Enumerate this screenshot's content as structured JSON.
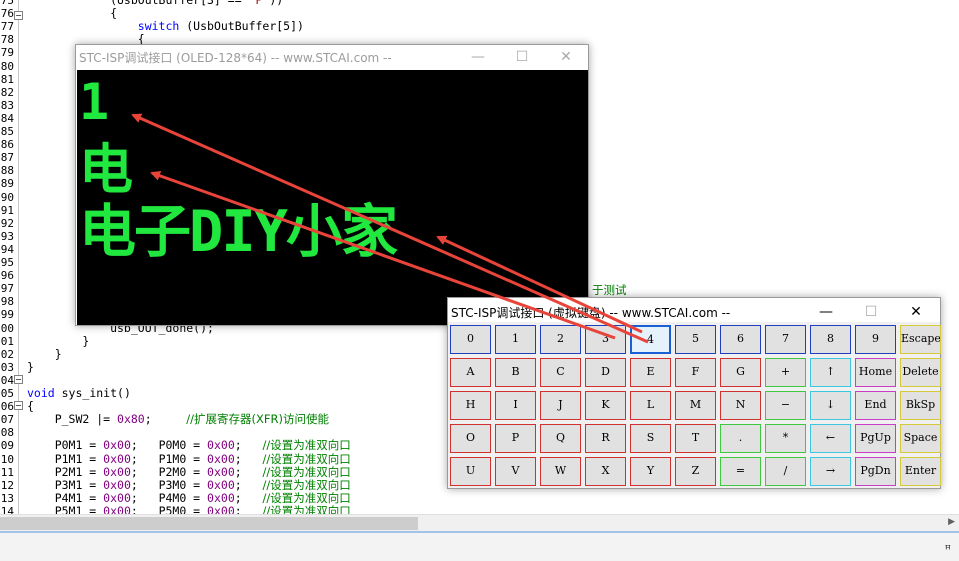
{
  "editor": {
    "lines": [
      {
        "n": "75",
        "parts": [
          [
            "",
            "            (UsbOutBuffer[3] == "
          ],
          [
            "str",
            "'P'"
          ],
          [
            "",
            "))"
          ]
        ]
      },
      {
        "n": "76",
        "parts": [
          [
            "",
            "            {"
          ]
        ]
      },
      {
        "n": "77",
        "parts": [
          [
            "",
            "                "
          ],
          [
            "kw",
            "switch"
          ],
          [
            "",
            " (UsbOutBuffer[5])"
          ]
        ]
      },
      {
        "n": "78",
        "parts": [
          [
            "",
            "                {"
          ]
        ]
      },
      {
        "n": "79",
        "parts": []
      },
      {
        "n": "80",
        "parts": []
      },
      {
        "n": "81",
        "parts": []
      },
      {
        "n": "82",
        "parts": []
      },
      {
        "n": "83",
        "parts": []
      },
      {
        "n": "84",
        "parts": []
      },
      {
        "n": "85",
        "parts": []
      },
      {
        "n": "86",
        "parts": []
      },
      {
        "n": "87",
        "parts": []
      },
      {
        "n": "88",
        "parts": []
      },
      {
        "n": "89",
        "parts": []
      },
      {
        "n": "90",
        "parts": []
      },
      {
        "n": "91",
        "parts": []
      },
      {
        "n": "92",
        "parts": []
      },
      {
        "n": "93",
        "parts": []
      },
      {
        "n": "94",
        "parts": []
      },
      {
        "n": "95",
        "parts": []
      },
      {
        "n": "96",
        "parts": []
      },
      {
        "n": "97",
        "parts": []
      },
      {
        "n": "98",
        "parts": []
      },
      {
        "n": "99",
        "parts": []
      },
      {
        "n": "00",
        "parts": [
          [
            "",
            "            usb_OUT_done();"
          ]
        ]
      },
      {
        "n": "01",
        "parts": [
          [
            "",
            "        }"
          ]
        ]
      },
      {
        "n": "02",
        "parts": [
          [
            "",
            "    }"
          ]
        ]
      },
      {
        "n": "03",
        "parts": [
          [
            "",
            "}"
          ]
        ]
      },
      {
        "n": "04",
        "parts": []
      },
      {
        "n": "05",
        "parts": [
          [
            "kw",
            "void"
          ],
          [
            "",
            " sys_init()"
          ]
        ]
      },
      {
        "n": "06",
        "parts": [
          [
            "",
            "{"
          ]
        ]
      },
      {
        "n": "07",
        "parts": [
          [
            "",
            "    P_SW2 |= "
          ],
          [
            "num",
            "0x80"
          ],
          [
            "",
            ";     "
          ],
          [
            "cm",
            "//扩展寄存器(XFR)访问使能"
          ]
        ]
      },
      {
        "n": "08",
        "parts": []
      },
      {
        "n": "09",
        "parts": [
          [
            "",
            "    P0M1 = "
          ],
          [
            "num",
            "0x00"
          ],
          [
            "",
            ";   P0M0 = "
          ],
          [
            "num",
            "0x00"
          ],
          [
            "",
            ";   "
          ],
          [
            "cm",
            "//设置为准双向口"
          ]
        ]
      },
      {
        "n": "10",
        "parts": [
          [
            "",
            "    P1M1 = "
          ],
          [
            "num",
            "0x00"
          ],
          [
            "",
            ";   P1M0 = "
          ],
          [
            "num",
            "0x00"
          ],
          [
            "",
            ";   "
          ],
          [
            "cm",
            "//设置为准双向口"
          ]
        ]
      },
      {
        "n": "11",
        "parts": [
          [
            "",
            "    P2M1 = "
          ],
          [
            "num",
            "0x00"
          ],
          [
            "",
            ";   P2M0 = "
          ],
          [
            "num",
            "0x00"
          ],
          [
            "",
            ";   "
          ],
          [
            "cm",
            "//设置为准双向口"
          ]
        ]
      },
      {
        "n": "12",
        "parts": [
          [
            "",
            "    P3M1 = "
          ],
          [
            "num",
            "0x00"
          ],
          [
            "",
            ";   P3M0 = "
          ],
          [
            "num",
            "0x00"
          ],
          [
            "",
            ";   "
          ],
          [
            "cm",
            "//设置为准双向口"
          ]
        ]
      },
      {
        "n": "13",
        "parts": [
          [
            "",
            "    P4M1 = "
          ],
          [
            "num",
            "0x00"
          ],
          [
            "",
            ";   P4M0 = "
          ],
          [
            "num",
            "0x00"
          ],
          [
            "",
            ";   "
          ],
          [
            "cm",
            "//设置为准双向口"
          ]
        ]
      },
      {
        "n": "14",
        "parts": [
          [
            "",
            "    P5M1 = "
          ],
          [
            "num",
            "0x00"
          ],
          [
            "",
            ";   P5M0 = "
          ],
          [
            "num",
            "0x00"
          ],
          [
            "",
            ";   "
          ],
          [
            "cm",
            "//设置为准双向口"
          ]
        ]
      }
    ],
    "side_comment": "于测试"
  },
  "oled_window": {
    "title": "STC-ISP调试接口 (OLED-128*64) -- www.STCAI.com --",
    "minimize": "—",
    "maximize": "☐",
    "close": "✕",
    "lines": [
      "1",
      "电",
      "电子DIY小家"
    ]
  },
  "keyboard_window": {
    "title": "STC-ISP调试接口 (虚拟键盘) -- www.STCAI.com --",
    "minimize": "—",
    "maximize": "☐",
    "close": "✕",
    "selected_key": "4",
    "rows": [
      [
        {
          "l": "0",
          "c": "#1f3fbf"
        },
        {
          "l": "1",
          "c": "#1f3fbf"
        },
        {
          "l": "2",
          "c": "#1f3fbf"
        },
        {
          "l": "3",
          "c": "#1f3fbf"
        },
        {
          "l": "4",
          "c": "#1f3fbf"
        },
        {
          "l": "5",
          "c": "#1f3fbf"
        },
        {
          "l": "6",
          "c": "#1f3fbf"
        },
        {
          "l": "7",
          "c": "#1f3fbf"
        },
        {
          "l": "8",
          "c": "#1f3fbf"
        },
        {
          "l": "9",
          "c": "#1f3fbf"
        },
        {
          "l": "Escape",
          "c": "#d6c93a"
        }
      ],
      [
        {
          "l": "A",
          "c": "#d03030"
        },
        {
          "l": "B",
          "c": "#d03030"
        },
        {
          "l": "C",
          "c": "#d03030"
        },
        {
          "l": "D",
          "c": "#d03030"
        },
        {
          "l": "E",
          "c": "#d03030"
        },
        {
          "l": "F",
          "c": "#d03030"
        },
        {
          "l": "G",
          "c": "#d03030"
        },
        {
          "l": "+",
          "c": "#3ec93e"
        },
        {
          "l": "↑",
          "c": "#3cc7e0"
        },
        {
          "l": "Home",
          "c": "#c83cc8"
        },
        {
          "l": "Delete",
          "c": "#d6c93a"
        }
      ],
      [
        {
          "l": "H",
          "c": "#d03030"
        },
        {
          "l": "I",
          "c": "#d03030"
        },
        {
          "l": "J",
          "c": "#d03030"
        },
        {
          "l": "K",
          "c": "#d03030"
        },
        {
          "l": "L",
          "c": "#d03030"
        },
        {
          "l": "M",
          "c": "#d03030"
        },
        {
          "l": "N",
          "c": "#d03030"
        },
        {
          "l": "−",
          "c": "#3ec93e"
        },
        {
          "l": "↓",
          "c": "#3cc7e0"
        },
        {
          "l": "End",
          "c": "#c83cc8"
        },
        {
          "l": "BkSp",
          "c": "#d6c93a"
        }
      ],
      [
        {
          "l": "O",
          "c": "#d03030"
        },
        {
          "l": "P",
          "c": "#d03030"
        },
        {
          "l": "Q",
          "c": "#d03030"
        },
        {
          "l": "R",
          "c": "#d03030"
        },
        {
          "l": "S",
          "c": "#d03030"
        },
        {
          "l": "T",
          "c": "#d03030"
        },
        {
          "l": ".",
          "c": "#3ec93e"
        },
        {
          "l": "*",
          "c": "#3ec93e"
        },
        {
          "l": "←",
          "c": "#3cc7e0"
        },
        {
          "l": "PgUp",
          "c": "#c83cc8"
        },
        {
          "l": "Space",
          "c": "#d6c93a"
        }
      ],
      [
        {
          "l": "U",
          "c": "#d03030"
        },
        {
          "l": "V",
          "c": "#d03030"
        },
        {
          "l": "W",
          "c": "#d03030"
        },
        {
          "l": "X",
          "c": "#d03030"
        },
        {
          "l": "Y",
          "c": "#d03030"
        },
        {
          "l": "Z",
          "c": "#d03030"
        },
        {
          "l": "=",
          "c": "#3ec93e"
        },
        {
          "l": "/",
          "c": "#3ec93e"
        },
        {
          "l": "→",
          "c": "#3cc7e0"
        },
        {
          "l": "PgDn",
          "c": "#c83cc8"
        },
        {
          "l": "Enter",
          "c": "#d6c93a"
        }
      ]
    ]
  },
  "statusbar": {
    "pin_icon": "pin-icon",
    "pin_glyph": "ꟸ"
  },
  "colors": {
    "oled_text": "#21e83f",
    "annotation_arrow": "#e8443a",
    "selected_key_border": "#1a5fd6"
  }
}
